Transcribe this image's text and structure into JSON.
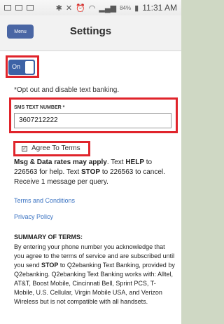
{
  "statusbar": {
    "battery": "84%",
    "time": "11:31 AM"
  },
  "header": {
    "menu_label": "Menu",
    "title": "Settings"
  },
  "toggle": {
    "label": "On",
    "state": "on"
  },
  "note": "*Opt out and disable text banking.",
  "sms": {
    "label": "SMS TEXT NUMBER *",
    "value": "3607212222"
  },
  "agree": {
    "label": "Agree To Terms",
    "checked": true
  },
  "message": {
    "lead": "Msg & Data rates may apply",
    "t1": ". Text ",
    "help": "HELP",
    "t2": " to 226563 for help. Text ",
    "stop": "STOP",
    "t3": " to 226563 to cancel. Receive 1 message per query."
  },
  "links": {
    "terms": "Terms and Conditions",
    "privacy": "Privacy Policy"
  },
  "summary": {
    "title": "SUMMARY OF TERMS:",
    "p1": "By entering your phone number you acknowledge that you agree to the terms of service and are subscribed until you send ",
    "stop": "STOP",
    "p2": " to Q2ebanking Text Banking, provided by Q2ebanking. Q2ebanking Text Banking works with: Alltel, AT&T, Boost Mobile, Cincinnati Bell, Sprint PCS, T-Mobile, U.S. Cellular, Virgin Mobile USA, and Verizon Wireless but is not compatible with all handsets."
  }
}
